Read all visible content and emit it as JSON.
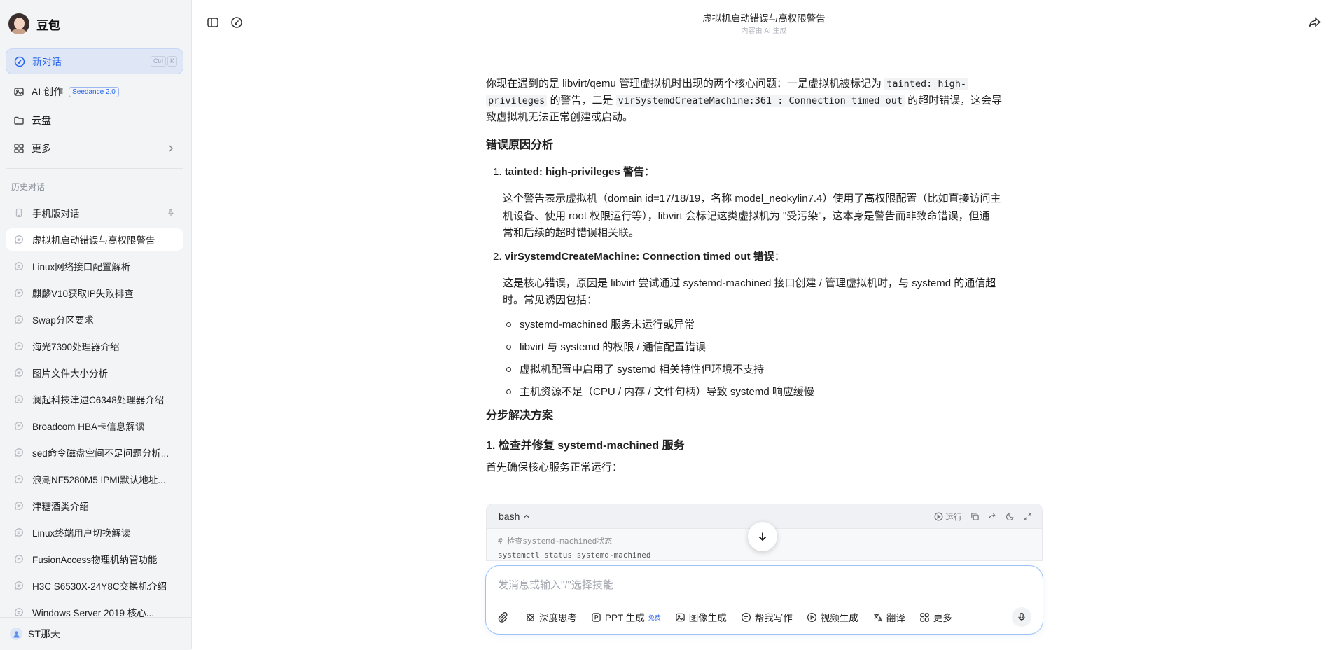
{
  "sidebar": {
    "brand": "豆包",
    "new_chat": {
      "label": "新对话",
      "shortcut": [
        "Ctrl",
        "K"
      ]
    },
    "nav": [
      {
        "label": "AI 创作",
        "badge": "Seedance 2.0"
      },
      {
        "label": "云盘"
      },
      {
        "label": "更多"
      }
    ],
    "history_title": "历史对话",
    "history": [
      "手机版对话",
      "虚拟机启动错误与高权限警告",
      "Linux网络接口配置解析",
      "麒麟V10获取IP失败排查",
      "Swap分区要求",
      "海光7390处理器介绍",
      "图片文件大小分析",
      "澜起科技津逮C6348处理器介绍",
      "Broadcom HBA卡信息解读",
      "sed命令磁盘空间不足问题分析...",
      "浪潮NF5280M5 IPMI默认地址...",
      "津糖酒类介绍",
      "Linux终端用户切换解读",
      "FusionAccess物理机纳管功能",
      "H3C S6530X-24Y8C交换机介绍",
      "Windows Server 2019 核心..."
    ],
    "user": "ST那天"
  },
  "header": {
    "title": "虚拟机启动错误与高权限警告",
    "subtitle": "内容由 AI 生成"
  },
  "content": {
    "intro_a": "你现在遇到的是 libvirt/qemu 管理虚拟机时出现的两个核心问题：一是虚拟机被标记为 ",
    "intro_code1a": "tainted: high-",
    "intro_code1b": "privileges",
    "intro_b": " 的警告，二是 ",
    "intro_code2": "virSystemdCreateMachine:361 : Connection timed out",
    "intro_c": " 的超时错误，这会导",
    "intro_d": "致虚拟机无法正常创建或启动。",
    "h_analysis": "错误原因分析",
    "item1_num": "1.",
    "item1_title": "tainted: high-privileges 警告",
    "item1_colon": "：",
    "item1_l1": "这个警告表示虚拟机（domain id=17/18/19，名称 model_neokylin7.4）使用了高权限配置（比如直接访问主",
    "item1_l2": "机设备、使用 root 权限运行等），libvirt 会标记这类虚拟机为 \"受污染\"，这本身是警告而非致命错误，但通",
    "item1_l3": "常和后续的超时错误相关联。",
    "item2_num": "2.",
    "item2_title": "virSystemdCreateMachine: Connection timed out 错误",
    "item2_colon": "：",
    "item2_l1": "这是核心错误，原因是 libvirt 尝试通过 systemd-machined 接口创建 / 管理虚拟机时，与 systemd 的通信超",
    "item2_l2": "时。常见诱因包括：",
    "bullets": [
      "systemd-machined 服务未运行或异常",
      "libvirt 与 systemd 的权限 / 通信配置错误",
      "虚拟机配置中启用了 systemd 相关特性但环境不支持",
      "主机资源不足（CPU / 内存 / 文件句柄）导致 systemd 响应缓慢"
    ],
    "h_solution": "分步解决方案",
    "step1": "1. 检查并修复 systemd-machined 服务",
    "step1_desc": "首先确保核心服务正常运行："
  },
  "code": {
    "lang": "bash",
    "run_label": "运行",
    "lines": [
      "# 检查systemd-machined状态",
      "systemctl status systemd-machined"
    ]
  },
  "composer": {
    "placeholder": "发消息或输入\"/\"选择技能",
    "tools": [
      {
        "label": "深度思考"
      },
      {
        "label": "PPT 生成",
        "tag": "免费"
      },
      {
        "label": "图像生成"
      },
      {
        "label": "帮我写作"
      },
      {
        "label": "视频生成"
      },
      {
        "label": "翻译"
      },
      {
        "label": "更多"
      }
    ]
  },
  "colors": {
    "accent": "#2563eb",
    "sidebar_bg": "#f3f4f6",
    "active_item_bg": "#dfe7f7"
  }
}
